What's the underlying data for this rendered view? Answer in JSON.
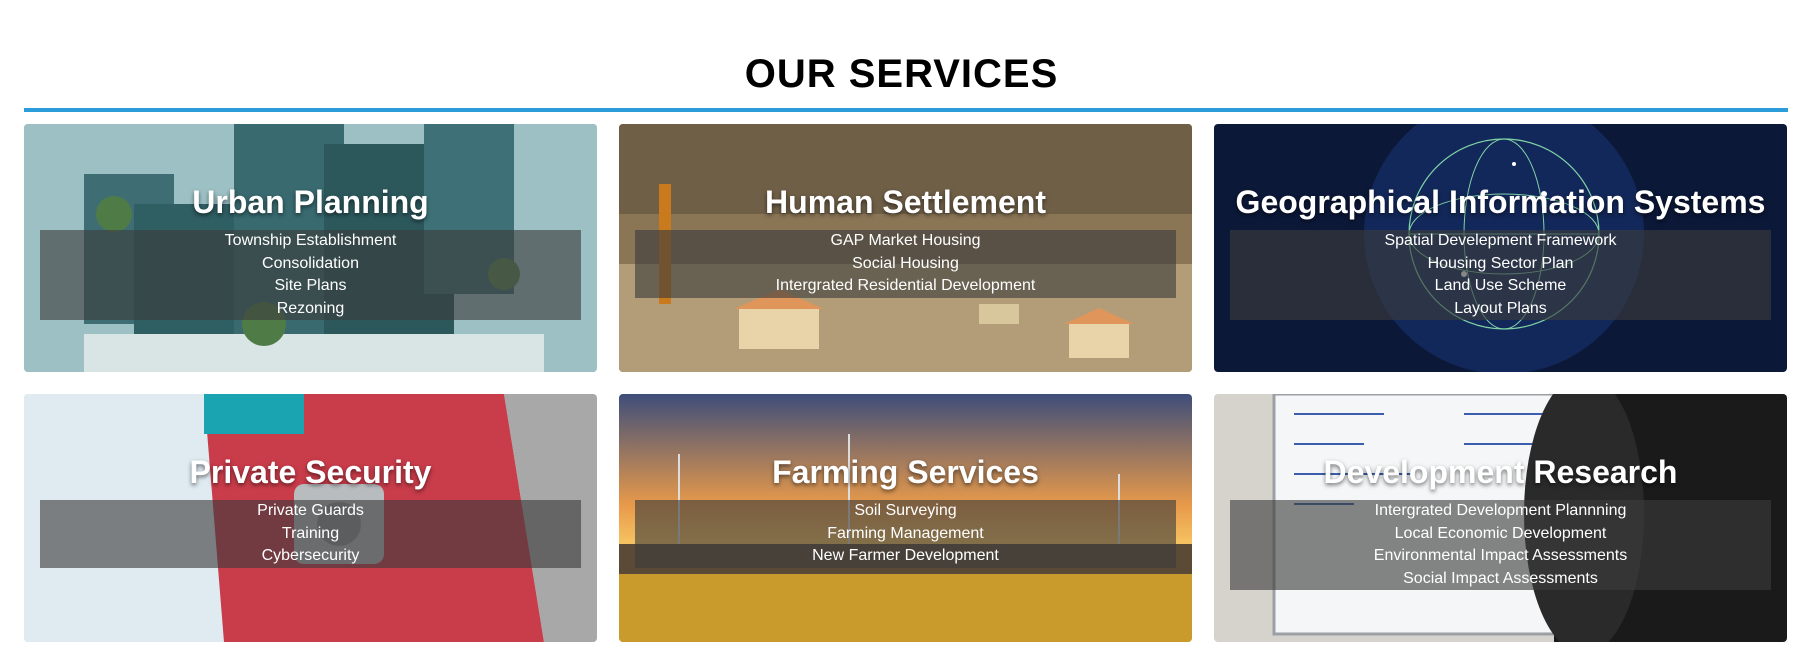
{
  "section": {
    "title": "OUR SERVICES",
    "accent": "#2d9cdb"
  },
  "services": [
    {
      "title": "Urban Planning",
      "items": [
        "Township Establishment",
        "Consolidation",
        "Site Plans",
        "Rezoning"
      ]
    },
    {
      "title": "Human Settlement",
      "items": [
        "GAP Market Housing",
        "Social Housing",
        "Intergrated Residential Development"
      ]
    },
    {
      "title": "Geographical Information Systems",
      "items": [
        "Spatial Develepment Framework",
        "Housing Sector Plan",
        "Land Use Scheme",
        "Layout Plans"
      ]
    },
    {
      "title": "Private Security",
      "items": [
        "Private Guards",
        "Training",
        "Cybersecurity"
      ]
    },
    {
      "title": "Farming Services",
      "items": [
        "Soil Surveying",
        "Farming Management",
        "New Farmer Development"
      ]
    },
    {
      "title": "Development Research",
      "items": [
        "Intergrated Development Plannning",
        "Local Economic Development",
        "Environmental Impact Assessments",
        "Social Impact Assessments"
      ]
    }
  ]
}
